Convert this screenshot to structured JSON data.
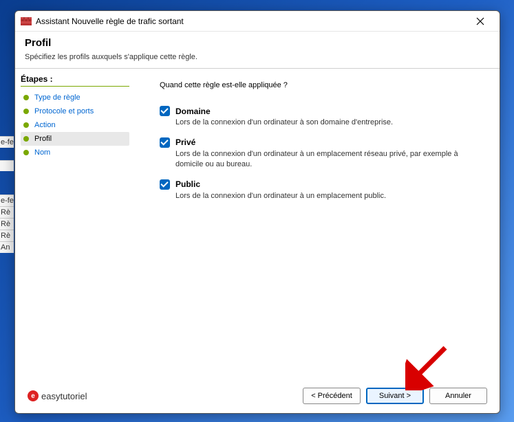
{
  "window": {
    "title": "Assistant Nouvelle règle de trafic sortant"
  },
  "header": {
    "title": "Profil",
    "description": "Spécifiez les profils auxquels s'applique cette règle."
  },
  "steps": {
    "heading": "Étapes :",
    "items": [
      {
        "label": "Type de règle",
        "active": false
      },
      {
        "label": "Protocole et ports",
        "active": false
      },
      {
        "label": "Action",
        "active": false
      },
      {
        "label": "Profil",
        "active": true
      },
      {
        "label": "Nom",
        "active": false
      }
    ]
  },
  "main": {
    "question": "Quand cette règle est-elle appliquée ?",
    "profiles": [
      {
        "label": "Domaine",
        "checked": true,
        "hint": "Lors de la connexion d'un ordinateur à son domaine d'entreprise."
      },
      {
        "label": "Privé",
        "checked": true,
        "hint": "Lors de la connexion d'un ordinateur à un emplacement réseau privé, par exemple à domicile ou au bureau."
      },
      {
        "label": "Public",
        "checked": true,
        "hint": "Lors de la connexion d'un ordinateur à un emplacement public."
      }
    ]
  },
  "footer": {
    "logo_text": "easytutoriel",
    "back": "< Précédent",
    "next": "Suivant >",
    "cancel": "Annuler"
  },
  "bg_fragments": [
    "e-fe",
    "e-fe",
    "Rè",
    "Rè",
    "Rè",
    "An"
  ]
}
